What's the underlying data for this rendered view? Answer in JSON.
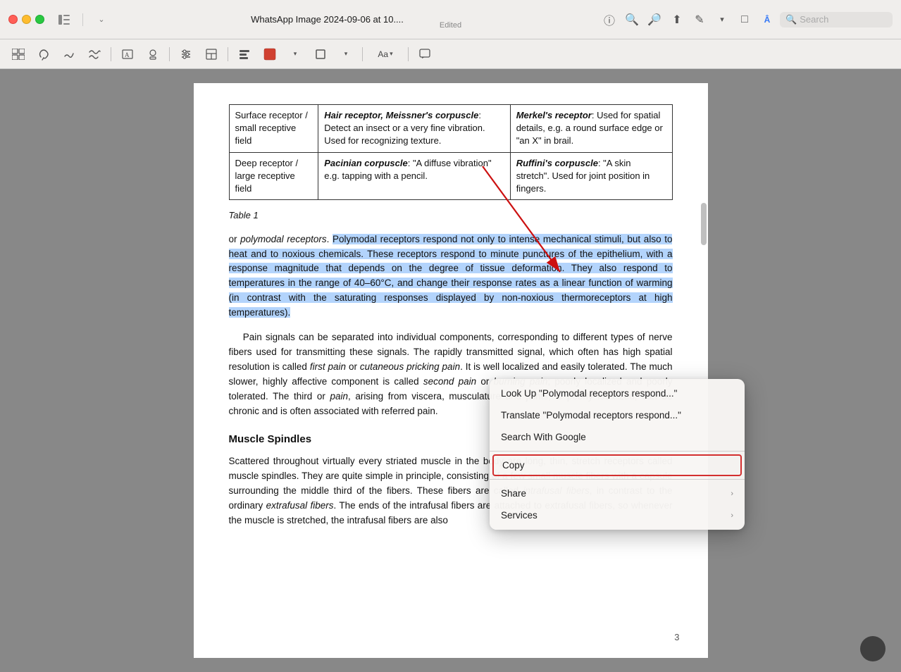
{
  "titlebar": {
    "title": "WhatsApp Image 2024-09-06 at 10....",
    "subtitle": "Edited"
  },
  "toolbar": {
    "buttons": [
      "sidebar-toggle",
      "lasso-icon",
      "pen-icon",
      "multipen-icon",
      "shape-icon",
      "stamp-icon",
      "adjust-icon",
      "layout-icon",
      "align-icon",
      "fill-icon",
      "border-icon",
      "font-icon",
      "comment-icon"
    ]
  },
  "search": {
    "placeholder": "Search"
  },
  "document": {
    "table": {
      "rows": [
        {
          "col1": "Surface receptor / small receptive field",
          "col2_label": "Hair receptor, Meissner's corpuscle",
          "col2_rest": ": Detect an insect or a very fine vibration. Used for recognizing texture.",
          "col3_label": "Merkel's receptor",
          "col3_rest": ": Used for spatial details, e.g. a round surface edge or \"an X\" in brail."
        },
        {
          "col1": "Deep receptor / large receptive field",
          "col2_label": "Pacinian corpuscle",
          "col2_rest": ": \"A diffuse vibration\" e.g. tapping with a pencil.",
          "col3_label": "Ruffini's corpuscle",
          "col3_rest": ": \"A skin stretch\". Used for joint position in fingers."
        }
      ]
    },
    "table_label": "Table 1",
    "paragraph1_before": "or ",
    "paragraph1_italic": "polymodal receptors",
    "paragraph1_normal": ". ",
    "paragraph1_selected": "Polymodal receptors respond not only to intense mechanical stimuli, but also to heat and to noxious chemicals. These receptors respond to minute punctures of the epithelium, with a response magnitude that depends on the degree of tissue deformation. They also respond to temperatures in the range of 40–60°C, and change their response rates as a linear function of warming (in contrast with the saturating responses displayed by non-noxious thermoreceptors at high temperatures).",
    "paragraph2": "Pain signals can be separated into individual components, corresponding to different types of nerve fibers used for transmitting these signals. The rapidly transmitted signal, which often has high spatial resolution is called ",
    "paragraph2_italic1": "first pain",
    "paragraph2_or": " or ",
    "paragraph2_italic2": "cutaneous pricking pain",
    "paragraph2_cont": ". It is well localized and easily tolerated. The much slower, highly affective component is called ",
    "paragraph2_italic3": "second pain",
    "paragraph2_or2": " or ",
    "paragraph2_italic4": "burning pain",
    "paragraph2_cont2": "; poorly localized and poorly tolerated. The third or ",
    "paragraph2_italic5": "pain",
    "paragraph2_cont3": ", arising from viscera, musculature and joints, is poorly localized, can be chronic and is often associated with referred pain.",
    "section_heading": "Muscle Spindles",
    "paragraph3": "Scattered throughout virtually every striated muscle in the body are long, thin, stretch receptors called muscle spindles. They are quite simple in principle, consisting of a few small muscle fibers with a capsule surrounding the middle third of the fibers. These fibers are called ",
    "paragraph3_italic1": "intrafusal fibers",
    "paragraph3_cont": ", in contrast to the ordinary ",
    "paragraph3_italic2": "extrafusal fibers",
    "paragraph3_cont2": ". The ends of the intrafusal fibers are attached to extrafusal fibers, so whenever the muscle is stretched, the intrafusal fibers are also",
    "page_number": "3"
  },
  "context_menu": {
    "items": [
      {
        "label": "Look Up \"Polymodal receptors respond...\"",
        "has_arrow": false
      },
      {
        "label": "Translate \"Polymodal receptors respond...\"",
        "has_arrow": false
      },
      {
        "label": "Search With Google",
        "has_arrow": false
      },
      {
        "label": "Copy",
        "has_arrow": false,
        "highlighted": true
      },
      {
        "label": "Share",
        "has_arrow": true
      },
      {
        "label": "Services",
        "has_arrow": true
      }
    ]
  }
}
